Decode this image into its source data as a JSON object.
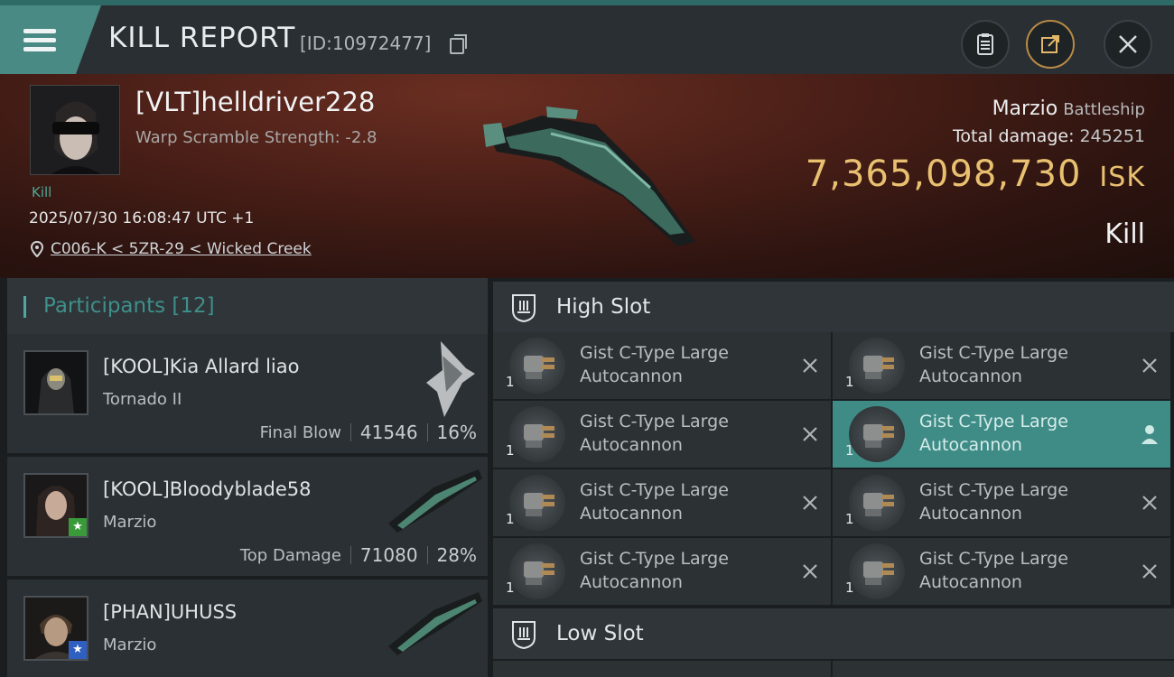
{
  "header": {
    "title": "KILL REPORT",
    "kill_id": "[ID:10972477]"
  },
  "victim": {
    "pilot": "[VLT]helldriver228",
    "scramble": "Warp Scramble Strength: -2.8",
    "kill_tag": "Kill",
    "timestamp": "2025/07/30 16:08:47 UTC +1",
    "location": "C006-K < 5ZR-29 < Wicked Creek",
    "ship_name": "Marzio",
    "ship_class": "Battleship",
    "total_damage_label": "Total damage:",
    "total_damage": "245251",
    "isk_value": "7,365,098,730",
    "isk_unit": "ISK",
    "result": "Kill"
  },
  "participants": {
    "title": "Participants",
    "count": "[12]",
    "items": [
      {
        "name": "[KOOL]Kia Allard liao",
        "ship": "Tornado II",
        "label": "Final Blow",
        "damage": "41546",
        "percent": "16%"
      },
      {
        "name": "[KOOL]Bloodyblade58",
        "ship": "Marzio",
        "label": "Top Damage",
        "damage": "71080",
        "percent": "28%"
      },
      {
        "name": "[PHAN]UHUSS",
        "ship": "Marzio",
        "label": "",
        "damage": "",
        "percent": ""
      }
    ]
  },
  "fitting": {
    "high_slot_title": "High Slot",
    "low_slot_title": "Low Slot",
    "modules": [
      {
        "line1": "Gist C-Type Large",
        "line2": "Autocannon",
        "qty": "1",
        "status": "destroyed"
      },
      {
        "line1": "Gist C-Type Large",
        "line2": "Autocannon",
        "qty": "1",
        "status": "destroyed"
      },
      {
        "line1": "Gist C-Type Large",
        "line2": "Autocannon",
        "qty": "1",
        "status": "destroyed"
      },
      {
        "line1": "Gist C-Type Large",
        "line2": "Autocannon",
        "qty": "1",
        "status": "dropped"
      },
      {
        "line1": "Gist C-Type Large",
        "line2": "Autocannon",
        "qty": "1",
        "status": "destroyed"
      },
      {
        "line1": "Gist C-Type Large",
        "line2": "Autocannon",
        "qty": "1",
        "status": "destroyed"
      },
      {
        "line1": "Gist C-Type Large",
        "line2": "Autocannon",
        "qty": "1",
        "status": "destroyed"
      },
      {
        "line1": "Gist C-Type Large",
        "line2": "Autocannon",
        "qty": "1",
        "status": "destroyed"
      }
    ]
  },
  "colors": {
    "accent_teal": "#4a8a84",
    "isk_gold": "#e8c070",
    "active_module": "#3f8c87"
  },
  "icons": [
    "menu-icon",
    "copy-icon",
    "clipboard-icon",
    "share-icon",
    "close-icon",
    "location-pin-icon",
    "high-slot-icon",
    "low-slot-icon",
    "remove-icon",
    "person-icon",
    "star-badge-icon"
  ]
}
